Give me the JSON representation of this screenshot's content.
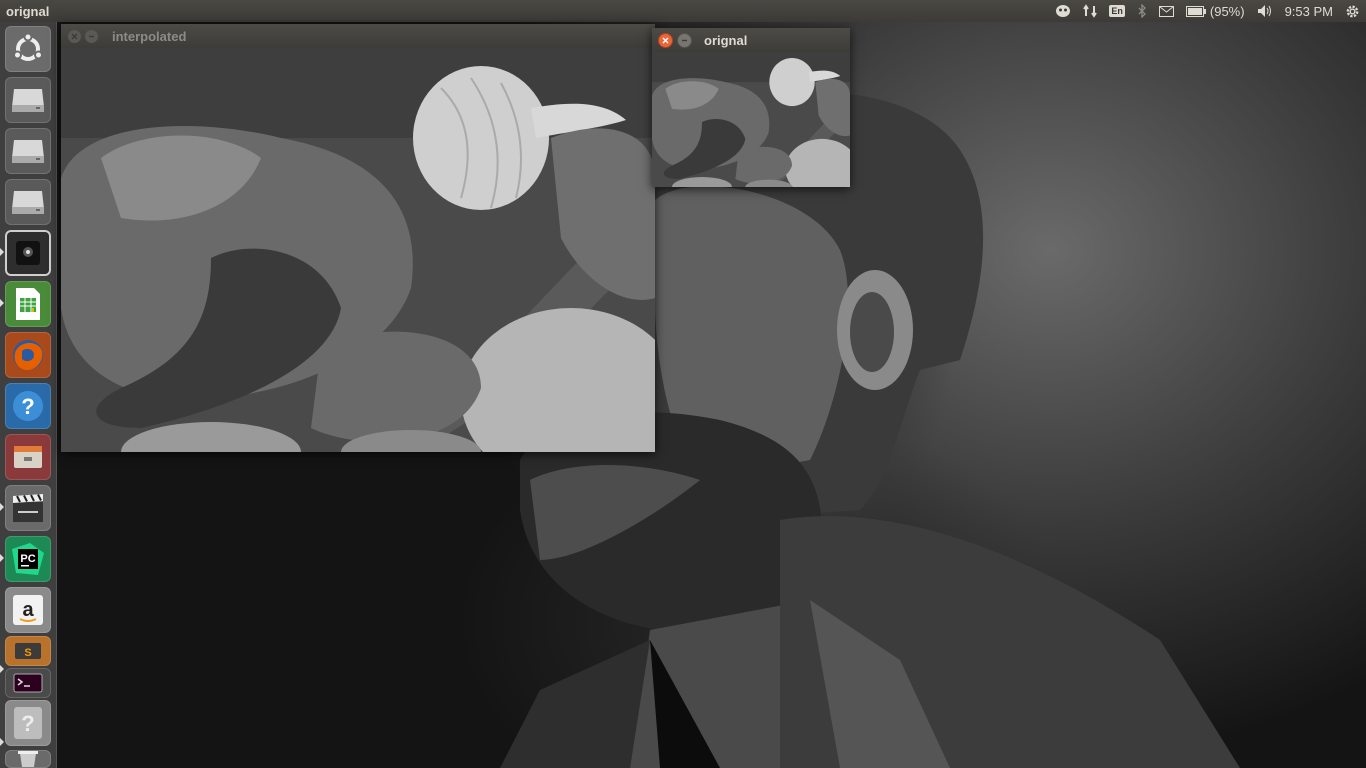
{
  "panel": {
    "app_title": "orignal",
    "keyboard_layout": "En",
    "battery": "(95%)",
    "clock": "9:53 PM"
  },
  "launcher": {
    "items": [
      {
        "icon": "ubuntu-dash-icon"
      },
      {
        "icon": "drive-icon"
      },
      {
        "icon": "drive-icon"
      },
      {
        "icon": "drive-icon"
      },
      {
        "icon": "webcam-icon"
      },
      {
        "icon": "libreoffice-calc-icon"
      },
      {
        "icon": "firefox-icon"
      },
      {
        "icon": "help-icon"
      },
      {
        "icon": "files-icon"
      },
      {
        "icon": "video-editor-icon"
      },
      {
        "icon": "pycharm-icon"
      },
      {
        "icon": "amazon-icon"
      },
      {
        "icon": "sublime-text-icon"
      },
      {
        "icon": "terminal-icon"
      },
      {
        "icon": "unknown-app-icon"
      },
      {
        "icon": "trash-icon"
      }
    ],
    "pycharm_label": "PC",
    "amazon_label": "a",
    "help_label": "?"
  },
  "windows": {
    "interpolated": {
      "title": "interpolated"
    },
    "orignal": {
      "title": "orignal"
    }
  },
  "colors": {
    "panel_bg": "#3c3b37",
    "close_active": "#e9653a",
    "firefox_orange": "#e66000",
    "calc_green": "#3fa33f",
    "pycharm_green": "#21d789"
  }
}
